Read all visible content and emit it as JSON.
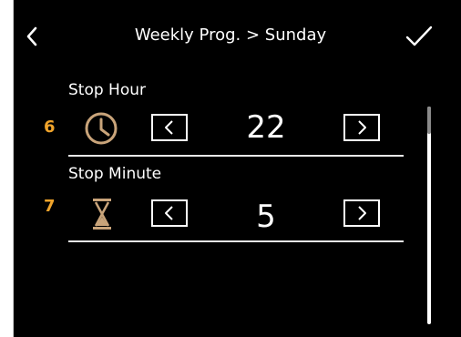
{
  "header": {
    "title": "Weekly Prog. > Sunday",
    "back_icon": "chevron-left-icon",
    "confirm_icon": "checkmark-icon"
  },
  "rows": [
    {
      "marker": "6",
      "label": "Stop Hour",
      "icon": "clock-icon",
      "value": "22"
    },
    {
      "marker": "7",
      "label": "Stop Minute",
      "icon": "hourglass-icon",
      "value": "5"
    }
  ],
  "colors": {
    "background": "#000000",
    "foreground": "#ffffff",
    "marker": "#f0a42b",
    "icon_accent": "#c9a47a"
  }
}
